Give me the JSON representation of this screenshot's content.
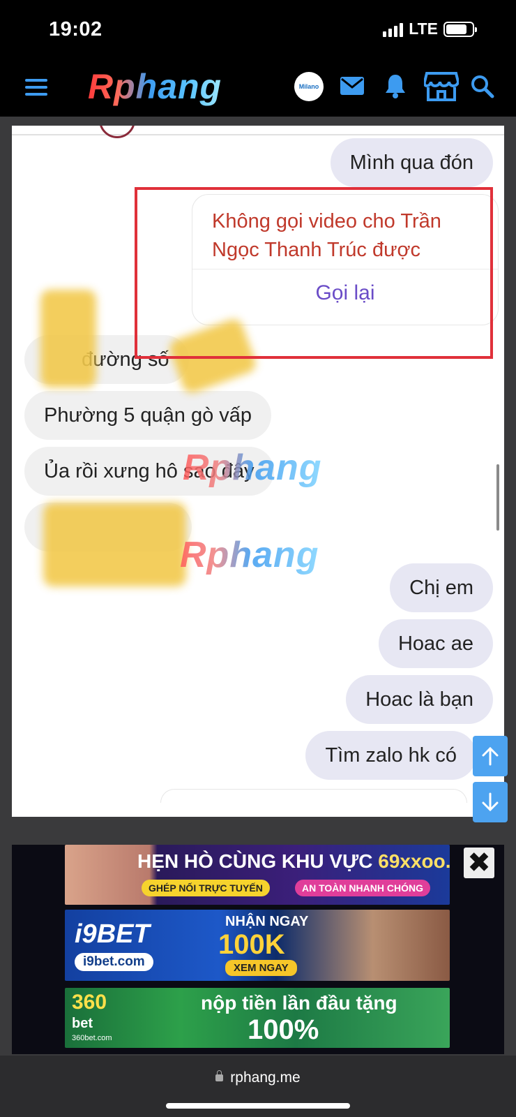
{
  "status_bar": {
    "time": "19:02",
    "network": "LTE"
  },
  "header": {
    "logo": "Rphang",
    "avatar_text": "Milano",
    "icons": [
      "menu-icon",
      "mail-icon",
      "bell-icon",
      "store-icon",
      "search-icon"
    ]
  },
  "chat": {
    "messages": [
      {
        "side": "me",
        "text": "Mình qua đón"
      },
      {
        "side": "them",
        "text": "đường số"
      },
      {
        "side": "them",
        "text": "Phường 5 quận gò vấp"
      },
      {
        "side": "them",
        "text": "Ủa rồi xưng hô sao đây"
      },
      {
        "side": "me",
        "text": "Chị em"
      },
      {
        "side": "me",
        "text": "Hoac ae"
      },
      {
        "side": "me",
        "text": "Hoac là bạn"
      },
      {
        "side": "me",
        "text": "Tìm zalo hk có"
      }
    ],
    "call_notice": {
      "title": "Không gọi video cho Trần Ngọc Thanh Trúc được",
      "action": "Gọi lại"
    },
    "watermark": "Rphang"
  },
  "ads": {
    "ad1": {
      "title": "HẸN HÒ CÙNG KHU VỰC",
      "site": "69xxoo.cc",
      "pill1": "GHÉP NỐI TRỰC TUYẾN",
      "pill2": "AN TOÀN NHANH CHÓNG"
    },
    "ad2": {
      "logo": "i9BET",
      "site": "i9bet.com",
      "headline": "NHẬN NGAY",
      "amount": "100K",
      "cta": "XEM NGAY"
    },
    "ad3": {
      "logo": "360",
      "logo_sub": "bet",
      "site": "360bet.com",
      "headline": "nộp tiền lần đầu tặng",
      "amount": "100%"
    },
    "close": "✖"
  },
  "browser": {
    "url": "rphang.me"
  },
  "colors": {
    "accent": "#3d9bf0",
    "call_error": "#c0392b",
    "call_action": "#6a4cc7",
    "highlight_frame": "#e0303a"
  }
}
